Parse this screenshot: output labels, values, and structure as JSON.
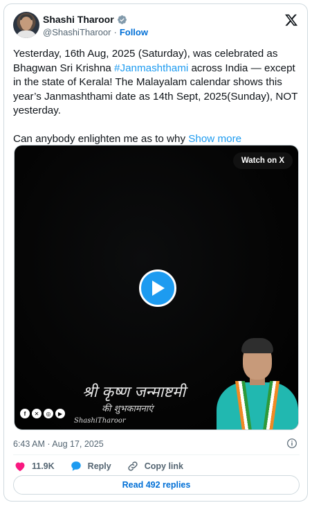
{
  "author": {
    "display_name": "Shashi Tharoor",
    "handle": "@ShashiTharoor",
    "follow_label": "Follow"
  },
  "tweet": {
    "text_part1": "Yesterday, 16th Aug, 2025 (Saturday), was celebrated as Bhagwan Sri Krishna ",
    "hashtag": "#Janmashthami",
    "text_part2": " across India — except in the state of Kerala! The  Malayalam calendar shows this year’s  Janmashthami date as 14th Sept, 2025(Sunday), NOT yesterday.\n\nCan anybody enlighten me as to why ",
    "show_more": "Show more"
  },
  "video": {
    "watch_label": "Watch on X",
    "greeting_line1": "श्री कृष्ण जन्माष्टमी",
    "greeting_line2": "की शुभकामनाएं",
    "watermark_handle": "ShashiTharoor",
    "social_icons": [
      "facebook-icon",
      "x-icon",
      "instagram-icon",
      "youtube-icon"
    ]
  },
  "meta": {
    "timestamp": "6:43 AM · Aug 17, 2025"
  },
  "actions": {
    "likes": "11.9K",
    "reply": "Reply",
    "copy_link": "Copy link"
  },
  "read_replies": "Read 492 replies",
  "colors": {
    "accent": "#1d9bf0",
    "link": "#006fd6",
    "like": "#f91880",
    "muted": "#536471"
  }
}
